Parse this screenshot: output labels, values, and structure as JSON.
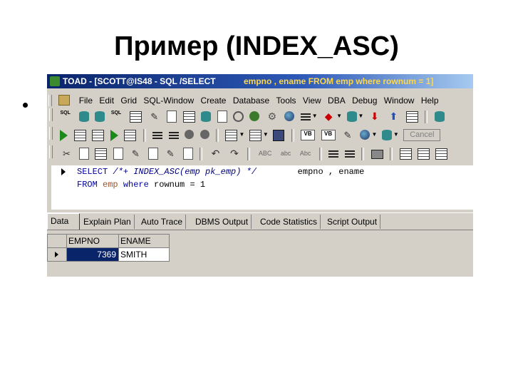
{
  "slide": {
    "title": "Пример (INDEX_ASC)"
  },
  "window": {
    "title_left": "TOAD - [SCOTT@IS48 - SQL /SELECT",
    "title_right": "empno , ename  FROM emp where rownum = 1]"
  },
  "menu": {
    "items": [
      "File",
      "Edit",
      "Grid",
      "SQL-Window",
      "Create",
      "Database",
      "Tools",
      "View",
      "DBA",
      "Debug",
      "Window",
      "Help"
    ]
  },
  "toolbar": {
    "sql_label": "SQL",
    "vb_label": "VB",
    "cancel_label": "Cancel",
    "abc_1": "ABC",
    "abc_2": "abc",
    "abc_3": "Abc"
  },
  "editor": {
    "line1_kw": "SELECT",
    "line1_hint": "/*+ INDEX_ASC(emp pk_emp) */",
    "line1_cols": "empno , ename",
    "line2_from": "FROM",
    "line2_table": "emp",
    "line2_where": "where",
    "line2_cond": "rownum = 1"
  },
  "tabs": [
    "Data",
    "Explain Plan",
    "Auto Trace",
    "DBMS Output",
    "Code Statistics",
    "Script Output"
  ],
  "grid": {
    "columns": [
      "EMPNO",
      "ENAME"
    ],
    "rows": [
      [
        "7369",
        "SMITH"
      ]
    ]
  }
}
